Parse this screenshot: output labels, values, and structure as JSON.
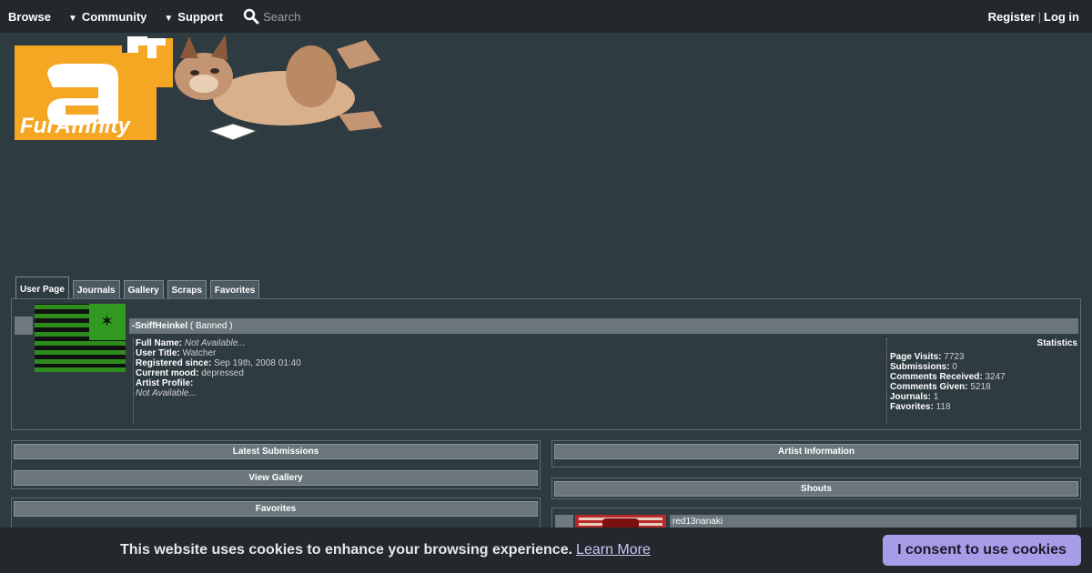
{
  "nav": {
    "browse": "Browse",
    "community": "Community",
    "support": "Support",
    "search_placeholder": "Search",
    "register": "Register",
    "separator": "|",
    "login": "Log in"
  },
  "logo": {
    "text": "FurAffinity",
    "letter": "a"
  },
  "tabs": [
    "User Page",
    "Journals",
    "Gallery",
    "Scraps",
    "Favorites"
  ],
  "profile": {
    "username": "-SniffHeinkel",
    "status": "( Banned )",
    "fields": [
      {
        "key": "Full Name:",
        "value": "Not Available..."
      },
      {
        "key": "User Title:",
        "value": "Watcher"
      },
      {
        "key": "Registered since:",
        "value": "Sep 19th, 2008 01:40"
      },
      {
        "key": "Current mood:",
        "value": "depressed"
      },
      {
        "key": "Artist Profile:",
        "value": ""
      },
      {
        "key": "",
        "value": "Not Available..."
      }
    ]
  },
  "stats": {
    "title": "Statistics",
    "items": [
      {
        "key": "Page Visits:",
        "value": "7723"
      },
      {
        "key": "Submissions:",
        "value": "0"
      },
      {
        "key": "Comments Received:",
        "value": "3247"
      },
      {
        "key": "Comments Given:",
        "value": "5218"
      },
      {
        "key": "Journals:",
        "value": "1"
      },
      {
        "key": "Favorites:",
        "value": "118"
      }
    ]
  },
  "sections": {
    "latest_submissions": "Latest Submissions",
    "view_gallery": "View Gallery",
    "favorites": "Favorites",
    "artist_information": "Artist Information",
    "shouts": "Shouts"
  },
  "shout": {
    "username": "red13nanaki"
  },
  "cookie": {
    "message": "This website uses cookies to enhance your browsing experience.",
    "learn_more": "Learn More",
    "consent_button": "I consent to use cookies"
  },
  "colors": {
    "page_bg": "#2e3b41",
    "nav_bg": "#22282c",
    "section_bar": "#6b767c",
    "logo_orange": "#f5a623",
    "consent_button": "#a79ce8"
  }
}
